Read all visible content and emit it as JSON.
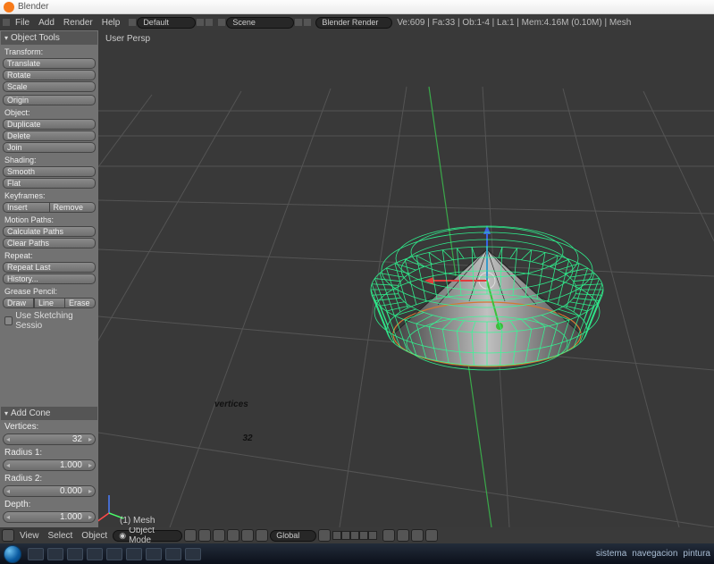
{
  "app_title": "Blender",
  "menus": [
    "File",
    "Add",
    "Render",
    "Help"
  ],
  "top": {
    "layout": "Default",
    "scene": "Scene",
    "engine": "Blender Render",
    "stats": "Ve:609 | Fa:33 | Ob:1-4 | La:1 | Mem:4.16M (0.10M) | Mesh"
  },
  "panel_head": "Object Tools",
  "groups": {
    "transform": {
      "label": "Transform",
      "btns": [
        "Translate",
        "Rotate",
        "Scale"
      ],
      "origin": "Origin"
    },
    "object": {
      "label": "Object",
      "btns": [
        "Duplicate",
        "Delete",
        "Join"
      ]
    },
    "shading": {
      "label": "Shading",
      "btns": [
        "Smooth",
        "Flat"
      ]
    },
    "keyframes": {
      "label": "Keyframes",
      "insert": "Insert",
      "remove": "Remove"
    },
    "motion": {
      "label": "Motion Paths",
      "btns": [
        "Calculate Paths",
        "Clear Paths"
      ]
    },
    "repeat": {
      "label": "Repeat",
      "btns": [
        "Repeat Last",
        "History..."
      ]
    },
    "gpencil": {
      "label": "Grease Pencil",
      "draw": "Draw",
      "line": "Line",
      "erase": "Erase",
      "chk": "Use Sketching Sessio"
    }
  },
  "addcone": {
    "head": "Add Cone",
    "verts": "Vertices",
    "verts_v": "32",
    "r1": "Radius 1",
    "r1_v": "1.000",
    "r2": "Radius 2",
    "r2_v": "0.000",
    "depth": "Depth",
    "depth_v": "1.000"
  },
  "vp": {
    "label": "User Persp",
    "mesh": "(1) Mesh"
  },
  "annotation": {
    "l1": "vertices",
    "l2": "32"
  },
  "header": {
    "view": "View",
    "select": "Select",
    "object": "Object",
    "mode": "Object Mode",
    "orient": "Global"
  },
  "taskbar": {
    "tray": [
      "sistema",
      "navegacion",
      "pintura"
    ]
  }
}
